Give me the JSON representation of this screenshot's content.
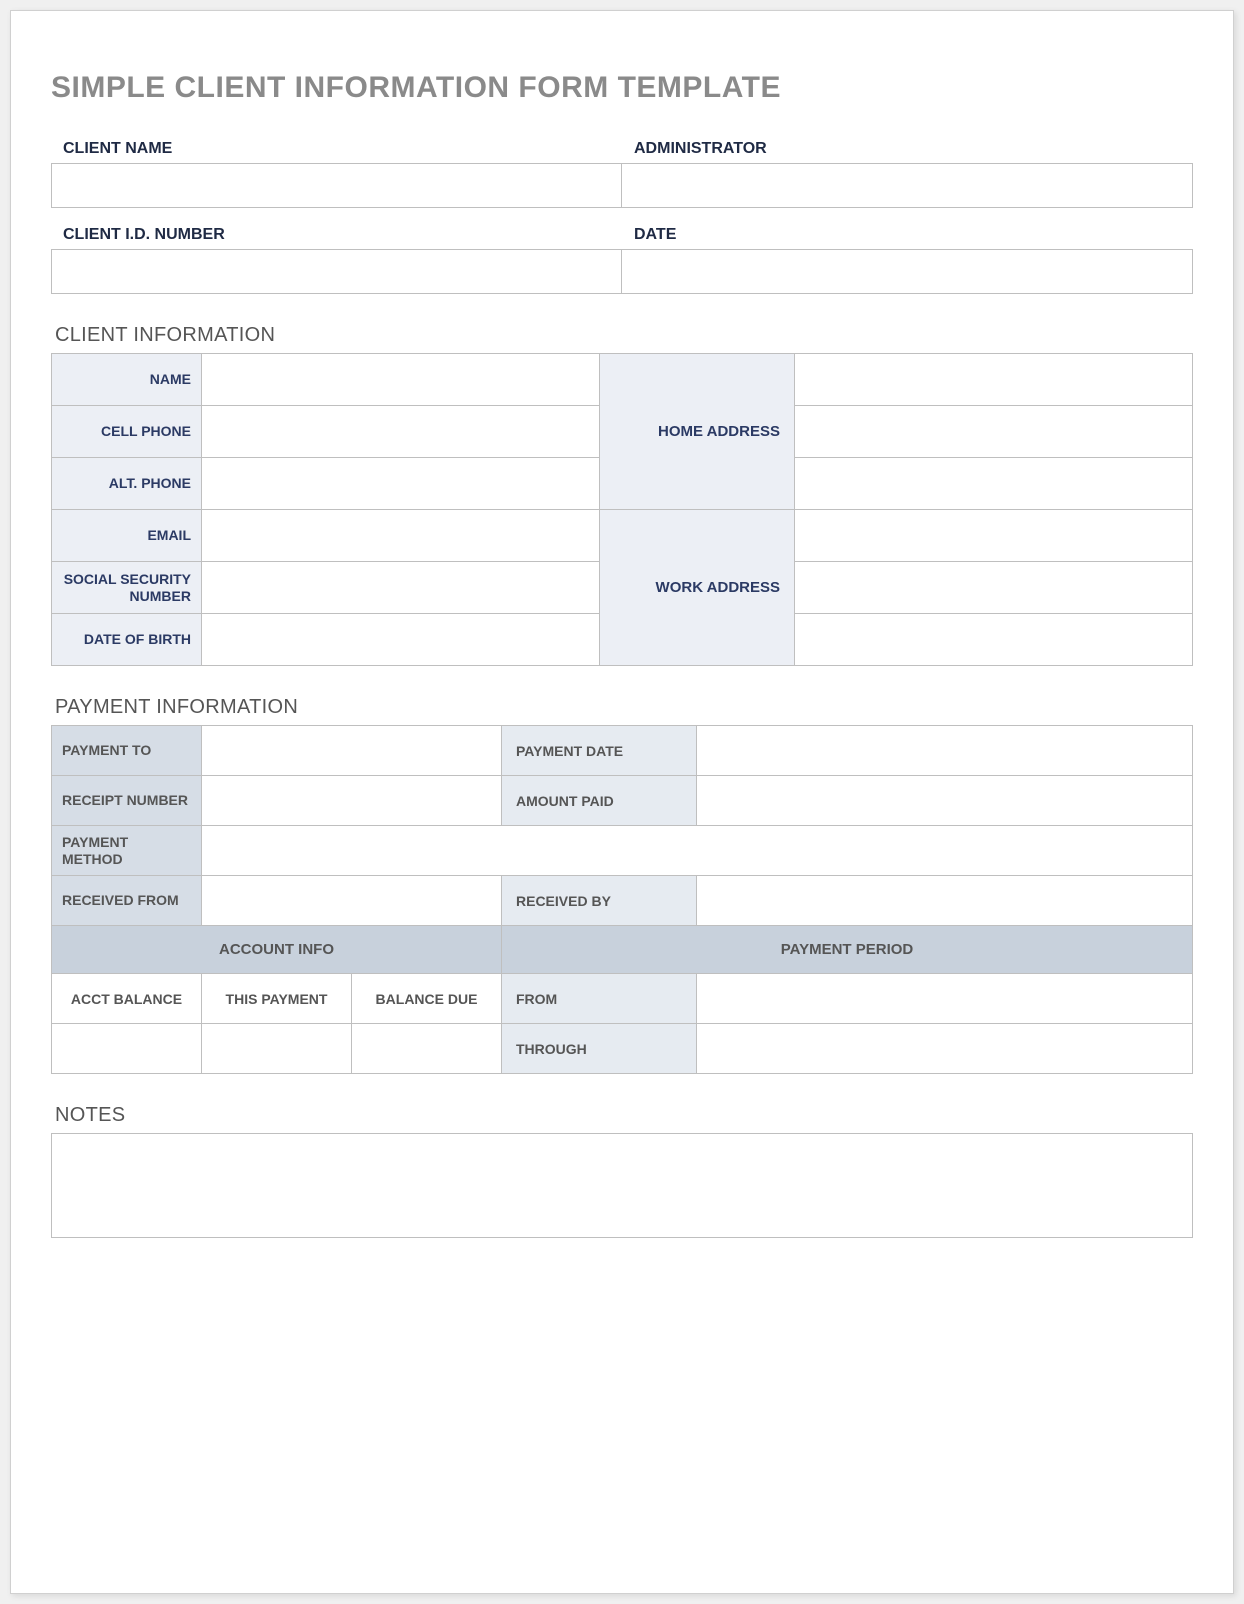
{
  "title": "SIMPLE CLIENT INFORMATION FORM TEMPLATE",
  "top": {
    "client_name_label": "CLIENT NAME",
    "administrator_label": "ADMINISTRATOR",
    "client_id_label": "CLIENT I.D. NUMBER",
    "date_label": "DATE",
    "client_name_value": "",
    "administrator_value": "",
    "client_id_value": "",
    "date_value": ""
  },
  "client_info": {
    "heading": "CLIENT INFORMATION",
    "labels": {
      "name": "NAME",
      "cell_phone": "CELL PHONE",
      "alt_phone": "ALT. PHONE",
      "email": "EMAIL",
      "ssn": "SOCIAL SECURITY NUMBER",
      "dob": "DATE OF BIRTH",
      "home_address": "HOME ADDRESS",
      "work_address": "WORK ADDRESS"
    },
    "values": {
      "name": "",
      "cell_phone": "",
      "alt_phone": "",
      "email": "",
      "ssn": "",
      "dob": "",
      "home_address_1": "",
      "home_address_2": "",
      "home_address_3": "",
      "work_address_1": "",
      "work_address_2": "",
      "work_address_3": ""
    }
  },
  "payment_info": {
    "heading": "PAYMENT INFORMATION",
    "labels": {
      "payment_to": "PAYMENT TO",
      "payment_date": "PAYMENT DATE",
      "receipt_number": "RECEIPT NUMBER",
      "amount_paid": "AMOUNT PAID",
      "payment_method": "PAYMENT METHOD",
      "received_from": "RECEIVED FROM",
      "received_by": "RECEIVED BY",
      "account_info": "ACCOUNT INFO",
      "payment_period": "PAYMENT PERIOD",
      "acct_balance": "ACCT BALANCE",
      "this_payment": "THIS PAYMENT",
      "balance_due": "BALANCE DUE",
      "from": "FROM",
      "through": "THROUGH"
    },
    "values": {
      "payment_to": "",
      "payment_date": "",
      "receipt_number": "",
      "amount_paid": "",
      "payment_method": "",
      "received_from": "",
      "received_by": "",
      "acct_balance": "",
      "this_payment": "",
      "balance_due": "",
      "from": "",
      "through": ""
    }
  },
  "notes": {
    "heading": "NOTES",
    "value": ""
  }
}
